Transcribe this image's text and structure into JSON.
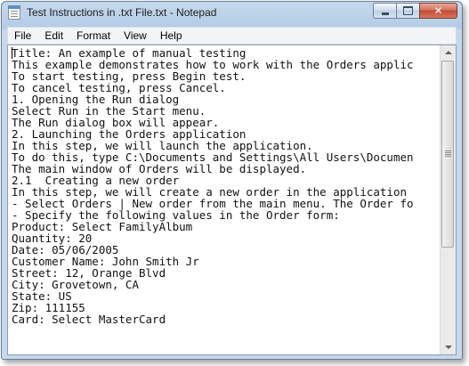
{
  "window": {
    "title": "Test Instructions in .txt File.txt - Notepad",
    "icon": "notepad-icon"
  },
  "caption_buttons": {
    "minimize": "minimize-icon",
    "maximize": "maximize-icon",
    "close": "close-icon",
    "close_glyph": "✕"
  },
  "menu": {
    "file": "File",
    "edit": "Edit",
    "format": "Format",
    "view": "View",
    "help": "Help"
  },
  "document": {
    "lines": [
      "Title: An example of manual testing",
      "This example demonstrates how to work with the Orders applic",
      "To start testing, press Begin test.",
      "To cancel testing, press Cancel.",
      "1. Opening the Run dialog",
      "Select Run in the Start menu.",
      "The Run dialog box will appear.",
      "2. Launching the Orders application",
      "In this step, we will launch the application.",
      "To do this, type C:\\Documents and Settings\\All Users\\Documen",
      "The main window of Orders will be displayed.",
      "2.1  Creating a new order",
      "In this step, we will create a new order in the application",
      "- Select Orders | New order from the main menu. The Order fo",
      "- Specify the following values in the Order form:",
      "Product: Select FamilyAlbum",
      "Quantity: 20",
      "Date: 05/06/2005",
      "Customer Name: John Smith Jr",
      "Street: 12, Orange Blvd",
      "City: Grovetown, CA",
      "State: US",
      "Zip: 111155",
      "Card: Select MasterCard"
    ]
  }
}
